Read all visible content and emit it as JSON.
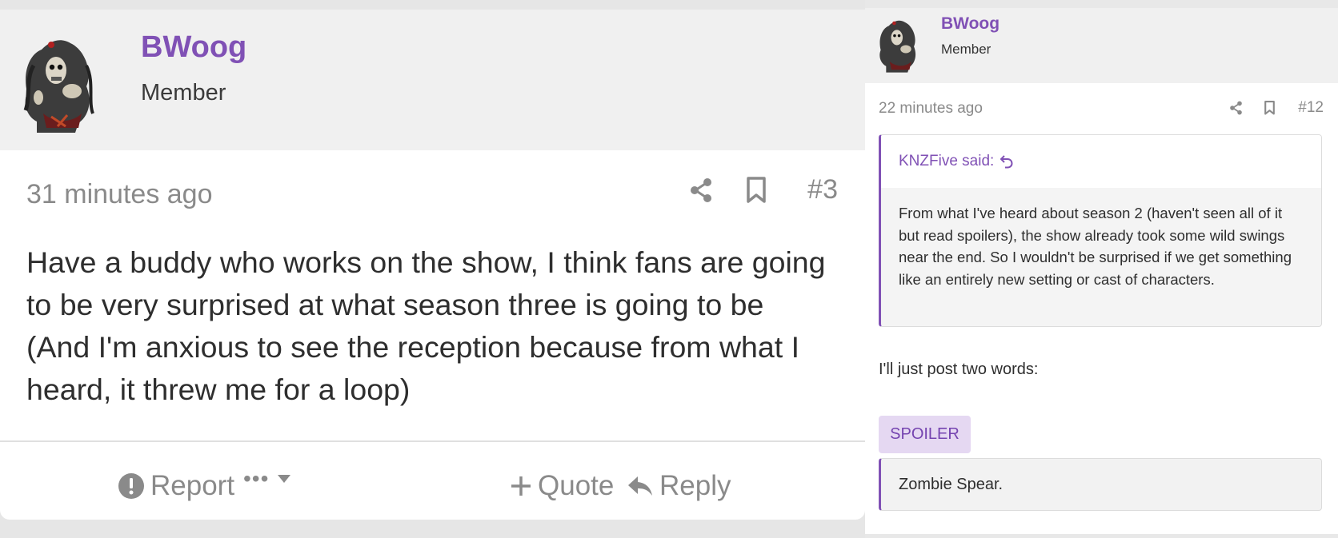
{
  "left_post": {
    "author": "BWoog",
    "role": "Member",
    "time": "31 minutes ago",
    "post_number": "#3",
    "body": "Have a buddy who works on the show, I think fans are going to be very surprised at what season three is going to be (And I'm anxious to see the reception because from what I heard, it threw me for a loop)",
    "footer": {
      "report_label": "Report",
      "more_label": "•••",
      "quote_label": "Quote",
      "reply_label": "Reply"
    }
  },
  "right_post": {
    "author": "BWoog",
    "role": "Member",
    "time": "22 minutes ago",
    "post_number": "#12",
    "quote": {
      "attribution": "KNZFive said:",
      "text": "From what I've heard about season 2 (haven't seen all of it but read spoilers), the show already took some wild swings near the end. So I wouldn't be surprised if we get something like an entirely new setting or cast of characters."
    },
    "text": "I'll just post two words:",
    "spoiler_label": "SPOILER",
    "spoiler_content": "Zombie Spear."
  },
  "icons": {
    "share": "share-icon",
    "bookmark": "bookmark-icon",
    "report": "exclamation-circle-icon",
    "more": "ellipsis-icon",
    "dropdown": "caret-down-icon",
    "quote": "plus-icon",
    "reply": "reply-arrow-icon",
    "quote_jump": "return-arrow-icon"
  },
  "colors": {
    "accent": "#8051b5",
    "muted_text": "#8a8a8a",
    "spoiler_bg": "#e5d8f2"
  }
}
